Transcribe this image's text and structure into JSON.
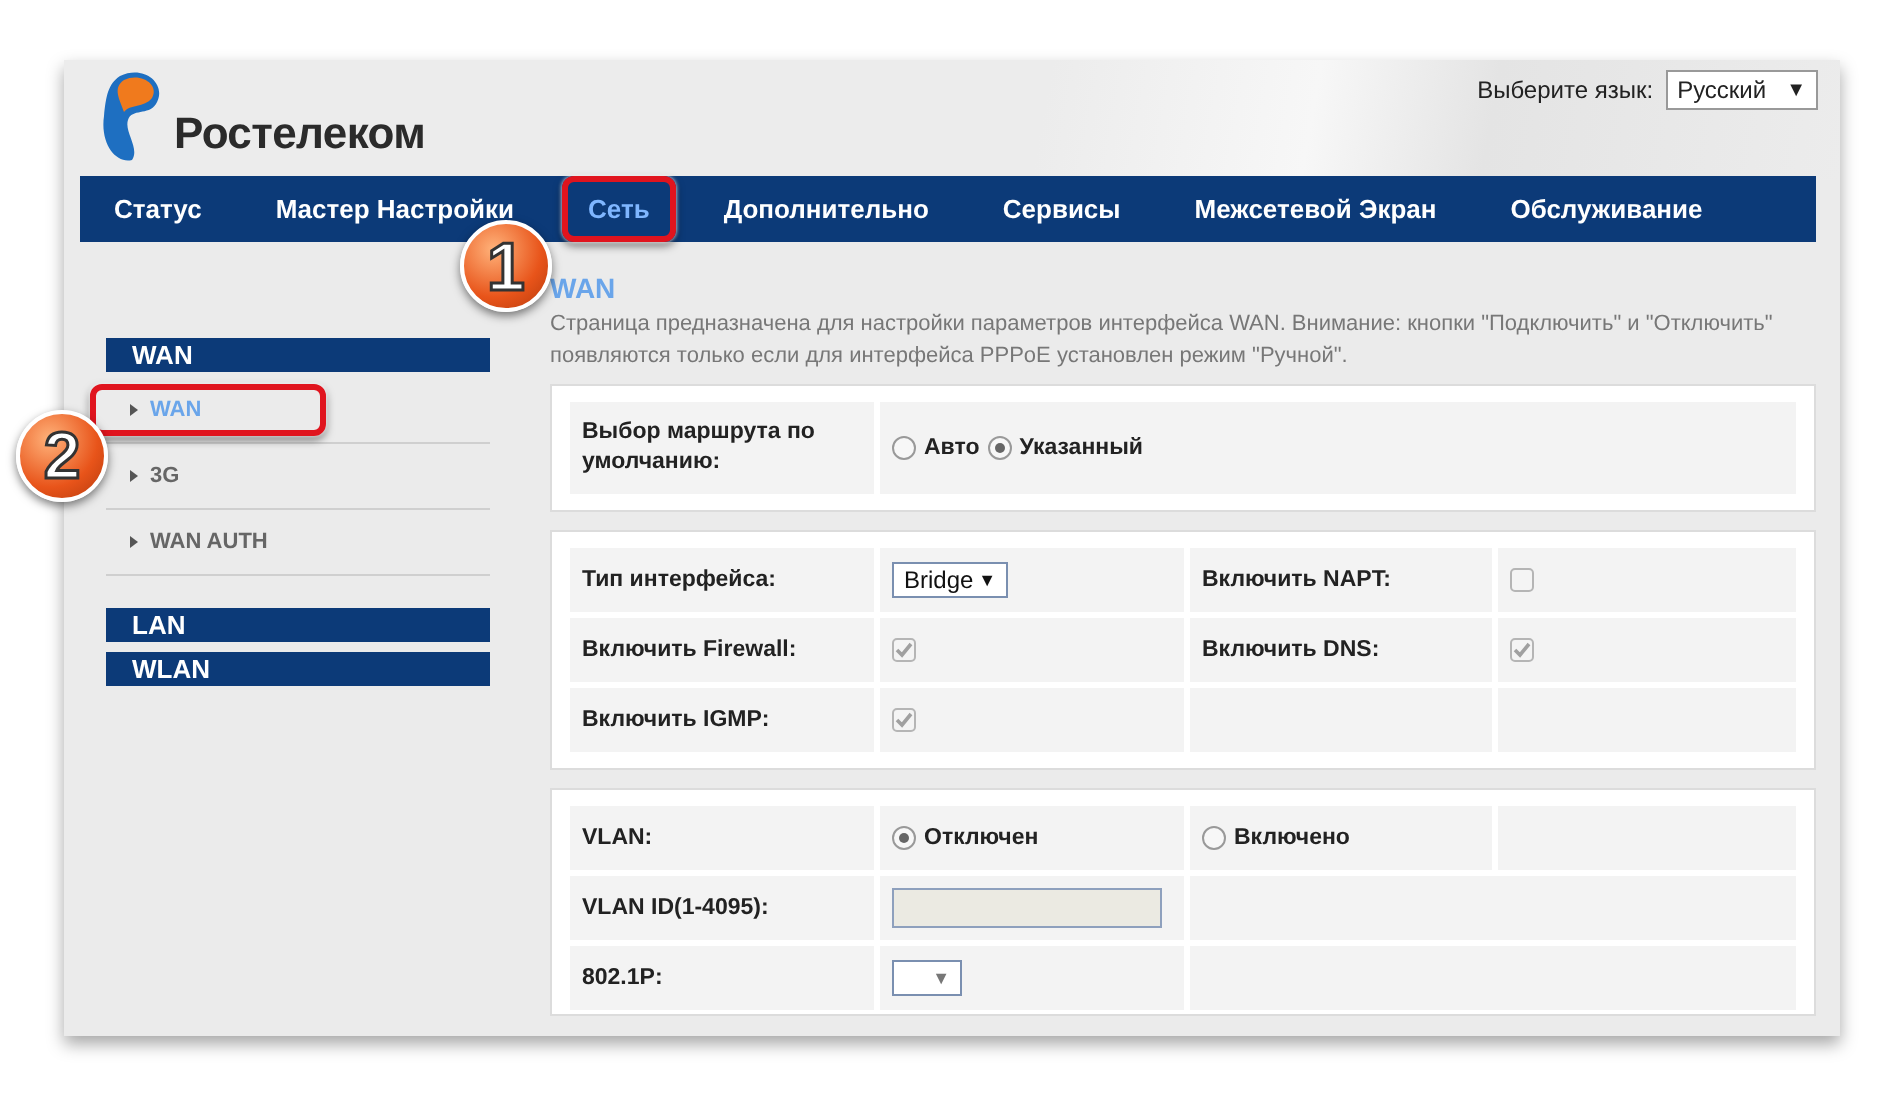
{
  "language": {
    "label": "Выберите язык:",
    "value": "Русский",
    "arrow": "▼"
  },
  "logo": {
    "text": "Ростелеком"
  },
  "nav": [
    {
      "label": "Статус",
      "selected": false
    },
    {
      "label": "Мастер Настройки",
      "selected": false
    },
    {
      "label": "Сеть",
      "selected": true
    },
    {
      "label": "Дополнительно",
      "selected": false
    },
    {
      "label": "Сервисы",
      "selected": false
    },
    {
      "label": "Межсетевой Экран",
      "selected": false
    },
    {
      "label": "Обслуживание",
      "selected": false
    }
  ],
  "sidebar": [
    {
      "title": "WAN",
      "items": [
        {
          "label": "WAN",
          "selected": true
        },
        {
          "label": "3G",
          "selected": false
        },
        {
          "label": "WAN AUTH",
          "selected": false
        }
      ]
    },
    {
      "title": "LAN"
    },
    {
      "title": "WLAN"
    }
  ],
  "page": {
    "title": "WAN",
    "description": "Страница предназначена для настройки параметров интерфейса WAN. Внимание: кнопки \"Подключить\" и \"Отключить\" появляются только если для интерфейса PPPoE установлен режим \"Ручной\"."
  },
  "route": {
    "label": "Выбор маршрута по умолчанию:",
    "options": [
      {
        "label": "Авто",
        "selected": false
      },
      {
        "label": "Указанный",
        "selected": true
      }
    ]
  },
  "interface": {
    "fields": [
      {
        "kind": "select",
        "label": "Тип интерфейса:",
        "value": "Bridge",
        "arrow": "▼"
      },
      {
        "kind": "checkbox",
        "label": "Включить NAPT:",
        "checked": false
      },
      {
        "kind": "checkbox",
        "label": "Включить Firewall:",
        "checked": true
      },
      {
        "kind": "checkbox",
        "label": "Включить DNS:",
        "checked": true
      },
      {
        "kind": "checkbox",
        "label": "Включить IGMP:",
        "checked": true
      }
    ]
  },
  "vlan": {
    "label": "VLAN:",
    "options": [
      {
        "label": "Отключен",
        "selected": true
      },
      {
        "label": "Включено",
        "selected": false
      }
    ],
    "id_label": "VLAN ID(1-4095):",
    "priority_label": "802.1P:",
    "priority_arrow": "▼"
  },
  "annotations": [
    {
      "kind": "nav",
      "text": "1"
    },
    {
      "kind": "sidebar",
      "text": "2"
    }
  ]
}
